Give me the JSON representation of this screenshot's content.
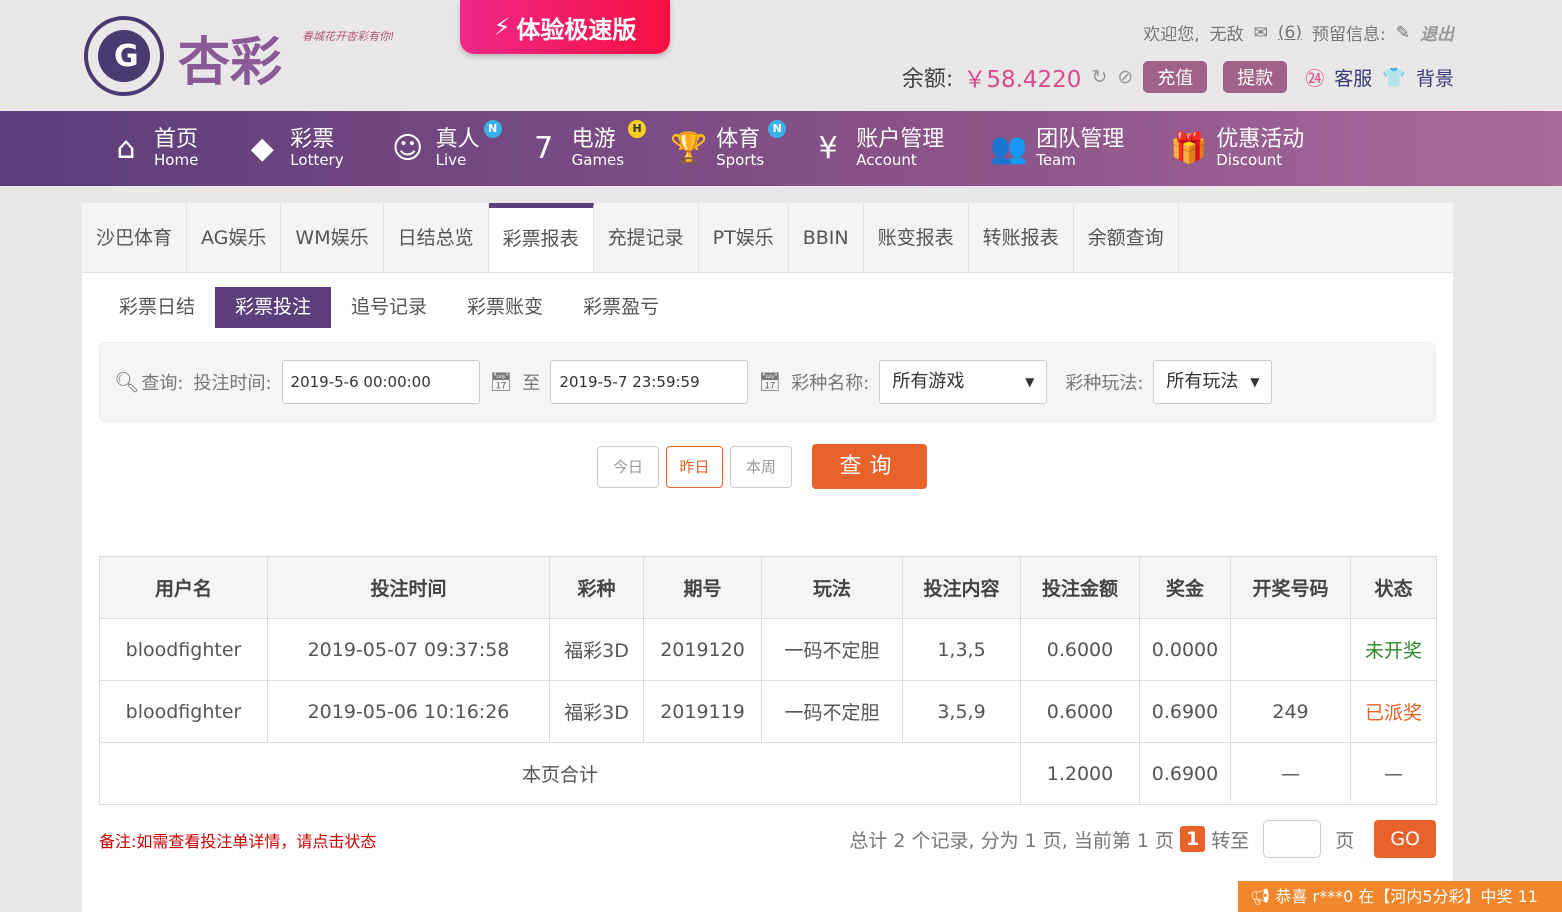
{
  "brand": {
    "name": "杏彩",
    "slogan": "春城花开杏彩有你!",
    "speed_label": "体验极速版"
  },
  "user": {
    "welcome": "欢迎您,",
    "name": "无敌",
    "messages": "(6)",
    "reserved": "预留信息:",
    "logout": "退出",
    "balance_label": "余额:",
    "balance": "￥58.4220",
    "deposit": "充值",
    "withdraw": "提款",
    "service": "客服",
    "background": "背景"
  },
  "nav": [
    {
      "cn": "首页",
      "en": "Home",
      "icon": "⌂"
    },
    {
      "cn": "彩票",
      "en": "Lottery",
      "icon": "◆"
    },
    {
      "cn": "真人",
      "en": "Live",
      "icon": "☺",
      "badge": "N"
    },
    {
      "cn": "电游",
      "en": "Games",
      "icon": "7",
      "badge": "H"
    },
    {
      "cn": "体育",
      "en": "Sports",
      "icon": "🏆",
      "badge": "N"
    },
    {
      "cn": "账户管理",
      "en": "Account",
      "icon": "¥"
    },
    {
      "cn": "团队管理",
      "en": "Team",
      "icon": "👥"
    },
    {
      "cn": "优惠活动",
      "en": "Discount",
      "icon": "🎁"
    }
  ],
  "tabs": [
    "沙巴体育",
    "AG娱乐",
    "WM娱乐",
    "日结总览",
    "彩票报表",
    "充提记录",
    "PT娱乐",
    "BBIN",
    "账变报表",
    "转账报表",
    "余额查询"
  ],
  "subtabs": [
    "彩票日结",
    "彩票投注",
    "追号记录",
    "彩票账变",
    "彩票盈亏"
  ],
  "filter": {
    "query": "查询:",
    "time_label": "投注时间:",
    "start": "2019-5-6 00:00:00",
    "to": "至",
    "end": "2019-5-7 23:59:59",
    "game_label": "彩种名称:",
    "game": "所有游戏",
    "play_label": "彩种玩法:",
    "play": "所有玩法"
  },
  "quick": [
    "今日",
    "昨日",
    "本周"
  ],
  "search": "查询",
  "table": {
    "headers": [
      "用户名",
      "投注时间",
      "彩种",
      "期号",
      "玩法",
      "投注内容",
      "投注金额",
      "奖金",
      "开奖号码",
      "状态"
    ],
    "rows": [
      [
        "bloodfighter",
        "2019-05-07 09:37:58",
        "福彩3D",
        "2019120",
        "一码不定胆",
        "1,3,5",
        "0.6000",
        "0.0000",
        "",
        "未开奖"
      ],
      [
        "bloodfighter",
        "2019-05-06 10:16:26",
        "福彩3D",
        "2019119",
        "一码不定胆",
        "3,5,9",
        "0.6000",
        "0.6900",
        "249",
        "已派奖"
      ]
    ],
    "total": {
      "label": "本页合计",
      "amount": "1.2000",
      "prize": "0.6900",
      "dash": "—"
    }
  },
  "colors": {
    "pending": "#2a8a2a",
    "paid": "#e8622a"
  },
  "note": "备注:如需查看投注单详情，请点击状态",
  "pager": {
    "summary": "总计 2 个记录, 分为 1 页, 当前第 1 页",
    "current": "1",
    "goto": "转至",
    "page": "页",
    "go": "GO"
  },
  "ticker": "恭喜 r***0 在【河内5分彩】中奖 11"
}
